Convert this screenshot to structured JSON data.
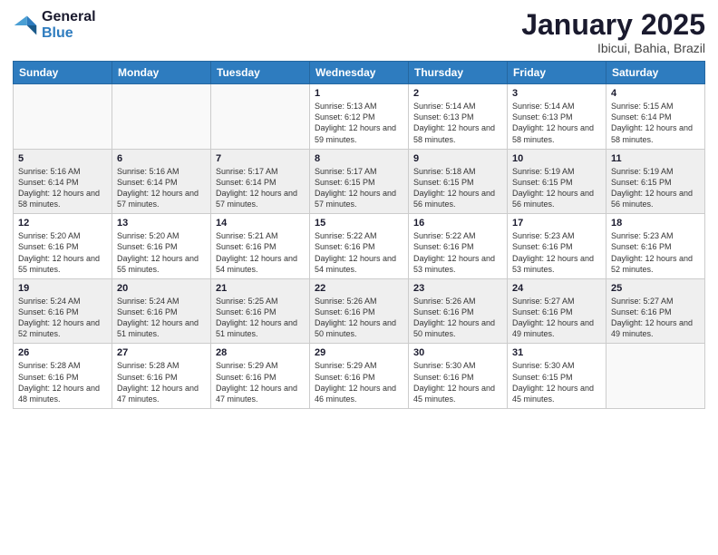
{
  "logo": {
    "line1": "General",
    "line2": "Blue"
  },
  "title": "January 2025",
  "subtitle": "Ibicui, Bahia, Brazil",
  "weekdays": [
    "Sunday",
    "Monday",
    "Tuesday",
    "Wednesday",
    "Thursday",
    "Friday",
    "Saturday"
  ],
  "weeks": [
    [
      {
        "day": "",
        "sunrise": "",
        "sunset": "",
        "daylight": ""
      },
      {
        "day": "",
        "sunrise": "",
        "sunset": "",
        "daylight": ""
      },
      {
        "day": "",
        "sunrise": "",
        "sunset": "",
        "daylight": ""
      },
      {
        "day": "1",
        "sunrise": "Sunrise: 5:13 AM",
        "sunset": "Sunset: 6:12 PM",
        "daylight": "Daylight: 12 hours and 59 minutes."
      },
      {
        "day": "2",
        "sunrise": "Sunrise: 5:14 AM",
        "sunset": "Sunset: 6:13 PM",
        "daylight": "Daylight: 12 hours and 58 minutes."
      },
      {
        "day": "3",
        "sunrise": "Sunrise: 5:14 AM",
        "sunset": "Sunset: 6:13 PM",
        "daylight": "Daylight: 12 hours and 58 minutes."
      },
      {
        "day": "4",
        "sunrise": "Sunrise: 5:15 AM",
        "sunset": "Sunset: 6:14 PM",
        "daylight": "Daylight: 12 hours and 58 minutes."
      }
    ],
    [
      {
        "day": "5",
        "sunrise": "Sunrise: 5:16 AM",
        "sunset": "Sunset: 6:14 PM",
        "daylight": "Daylight: 12 hours and 58 minutes."
      },
      {
        "day": "6",
        "sunrise": "Sunrise: 5:16 AM",
        "sunset": "Sunset: 6:14 PM",
        "daylight": "Daylight: 12 hours and 57 minutes."
      },
      {
        "day": "7",
        "sunrise": "Sunrise: 5:17 AM",
        "sunset": "Sunset: 6:14 PM",
        "daylight": "Daylight: 12 hours and 57 minutes."
      },
      {
        "day": "8",
        "sunrise": "Sunrise: 5:17 AM",
        "sunset": "Sunset: 6:15 PM",
        "daylight": "Daylight: 12 hours and 57 minutes."
      },
      {
        "day": "9",
        "sunrise": "Sunrise: 5:18 AM",
        "sunset": "Sunset: 6:15 PM",
        "daylight": "Daylight: 12 hours and 56 minutes."
      },
      {
        "day": "10",
        "sunrise": "Sunrise: 5:19 AM",
        "sunset": "Sunset: 6:15 PM",
        "daylight": "Daylight: 12 hours and 56 minutes."
      },
      {
        "day": "11",
        "sunrise": "Sunrise: 5:19 AM",
        "sunset": "Sunset: 6:15 PM",
        "daylight": "Daylight: 12 hours and 56 minutes."
      }
    ],
    [
      {
        "day": "12",
        "sunrise": "Sunrise: 5:20 AM",
        "sunset": "Sunset: 6:16 PM",
        "daylight": "Daylight: 12 hours and 55 minutes."
      },
      {
        "day": "13",
        "sunrise": "Sunrise: 5:20 AM",
        "sunset": "Sunset: 6:16 PM",
        "daylight": "Daylight: 12 hours and 55 minutes."
      },
      {
        "day": "14",
        "sunrise": "Sunrise: 5:21 AM",
        "sunset": "Sunset: 6:16 PM",
        "daylight": "Daylight: 12 hours and 54 minutes."
      },
      {
        "day": "15",
        "sunrise": "Sunrise: 5:22 AM",
        "sunset": "Sunset: 6:16 PM",
        "daylight": "Daylight: 12 hours and 54 minutes."
      },
      {
        "day": "16",
        "sunrise": "Sunrise: 5:22 AM",
        "sunset": "Sunset: 6:16 PM",
        "daylight": "Daylight: 12 hours and 53 minutes."
      },
      {
        "day": "17",
        "sunrise": "Sunrise: 5:23 AM",
        "sunset": "Sunset: 6:16 PM",
        "daylight": "Daylight: 12 hours and 53 minutes."
      },
      {
        "day": "18",
        "sunrise": "Sunrise: 5:23 AM",
        "sunset": "Sunset: 6:16 PM",
        "daylight": "Daylight: 12 hours and 52 minutes."
      }
    ],
    [
      {
        "day": "19",
        "sunrise": "Sunrise: 5:24 AM",
        "sunset": "Sunset: 6:16 PM",
        "daylight": "Daylight: 12 hours and 52 minutes."
      },
      {
        "day": "20",
        "sunrise": "Sunrise: 5:24 AM",
        "sunset": "Sunset: 6:16 PM",
        "daylight": "Daylight: 12 hours and 51 minutes."
      },
      {
        "day": "21",
        "sunrise": "Sunrise: 5:25 AM",
        "sunset": "Sunset: 6:16 PM",
        "daylight": "Daylight: 12 hours and 51 minutes."
      },
      {
        "day": "22",
        "sunrise": "Sunrise: 5:26 AM",
        "sunset": "Sunset: 6:16 PM",
        "daylight": "Daylight: 12 hours and 50 minutes."
      },
      {
        "day": "23",
        "sunrise": "Sunrise: 5:26 AM",
        "sunset": "Sunset: 6:16 PM",
        "daylight": "Daylight: 12 hours and 50 minutes."
      },
      {
        "day": "24",
        "sunrise": "Sunrise: 5:27 AM",
        "sunset": "Sunset: 6:16 PM",
        "daylight": "Daylight: 12 hours and 49 minutes."
      },
      {
        "day": "25",
        "sunrise": "Sunrise: 5:27 AM",
        "sunset": "Sunset: 6:16 PM",
        "daylight": "Daylight: 12 hours and 49 minutes."
      }
    ],
    [
      {
        "day": "26",
        "sunrise": "Sunrise: 5:28 AM",
        "sunset": "Sunset: 6:16 PM",
        "daylight": "Daylight: 12 hours and 48 minutes."
      },
      {
        "day": "27",
        "sunrise": "Sunrise: 5:28 AM",
        "sunset": "Sunset: 6:16 PM",
        "daylight": "Daylight: 12 hours and 47 minutes."
      },
      {
        "day": "28",
        "sunrise": "Sunrise: 5:29 AM",
        "sunset": "Sunset: 6:16 PM",
        "daylight": "Daylight: 12 hours and 47 minutes."
      },
      {
        "day": "29",
        "sunrise": "Sunrise: 5:29 AM",
        "sunset": "Sunset: 6:16 PM",
        "daylight": "Daylight: 12 hours and 46 minutes."
      },
      {
        "day": "30",
        "sunrise": "Sunrise: 5:30 AM",
        "sunset": "Sunset: 6:16 PM",
        "daylight": "Daylight: 12 hours and 45 minutes."
      },
      {
        "day": "31",
        "sunrise": "Sunrise: 5:30 AM",
        "sunset": "Sunset: 6:15 PM",
        "daylight": "Daylight: 12 hours and 45 minutes."
      },
      {
        "day": "",
        "sunrise": "",
        "sunset": "",
        "daylight": ""
      }
    ]
  ]
}
